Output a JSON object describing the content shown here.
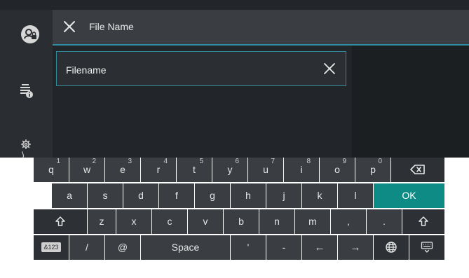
{
  "app": {
    "title": "File Name"
  },
  "field": {
    "value": "Filename"
  },
  "sidebar": {
    "settings_chevron": "⟩"
  },
  "keyboard": {
    "row1": [
      {
        "key": "q",
        "num": "1"
      },
      {
        "key": "w",
        "num": "2"
      },
      {
        "key": "e",
        "num": "3"
      },
      {
        "key": "r",
        "num": "4"
      },
      {
        "key": "t",
        "num": "5"
      },
      {
        "key": "y",
        "num": "6"
      },
      {
        "key": "u",
        "num": "7"
      },
      {
        "key": "i",
        "num": "8"
      },
      {
        "key": "o",
        "num": "9"
      },
      {
        "key": "p",
        "num": "0"
      }
    ],
    "row2": [
      "a",
      "s",
      "d",
      "f",
      "g",
      "h",
      "j",
      "k",
      "l"
    ],
    "ok": "OK",
    "row3": [
      "z",
      "x",
      "c",
      "v",
      "b",
      "n",
      "m",
      ",",
      "."
    ],
    "bottom": {
      "mode": "&123",
      "slash": "/",
      "at": "@",
      "space": "Space",
      "apostrophe": "'",
      "dash": "-",
      "left": "←",
      "right": "→"
    }
  },
  "icons": [
    "user-lock-icon",
    "close-icon",
    "job-info-icon",
    "gear-icon",
    "backspace-icon",
    "shift-icon",
    "globe-icon",
    "keyboard-hide-icon"
  ],
  "colors": {
    "accent": "#2f8ea6",
    "ok": "#0f8b85",
    "key": "#3a3e43",
    "bg": "#222529"
  }
}
